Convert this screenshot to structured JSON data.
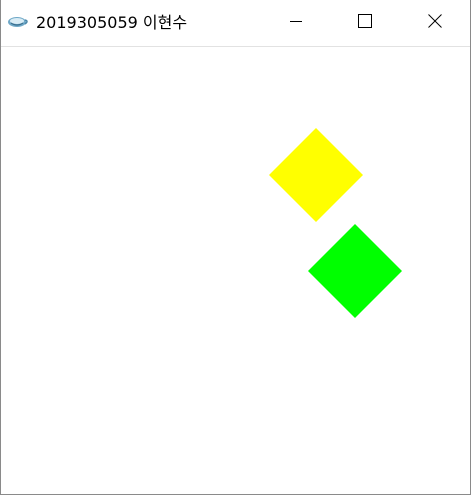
{
  "window": {
    "title": "2019305059 이현수",
    "app_icon": "java-cup-icon",
    "controls": {
      "minimize_icon": "minimize-icon",
      "maximize_icon": "maximize-icon",
      "close_icon": "close-icon"
    }
  },
  "canvas": {
    "background": "#ffffff",
    "shapes": [
      {
        "name": "yellow-diamond",
        "color": "#ffff00"
      },
      {
        "name": "green-diamond",
        "color": "#00ff00"
      }
    ]
  }
}
